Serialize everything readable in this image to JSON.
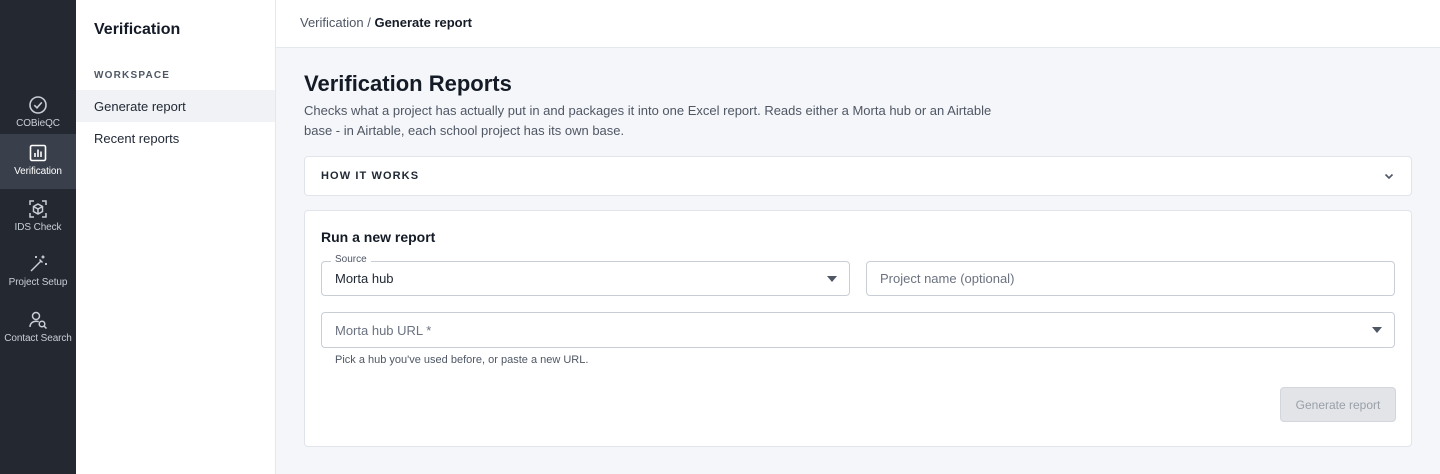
{
  "rail": {
    "items": [
      {
        "label": "COBieQC",
        "icon": "check-circle-icon"
      },
      {
        "label": "Verification",
        "icon": "bar-chart-icon"
      },
      {
        "label": "IDS Check",
        "icon": "cube-scan-icon"
      },
      {
        "label": "Project Setup",
        "icon": "magic-wand-icon"
      },
      {
        "label": "Contact Search",
        "icon": "user-search-icon"
      }
    ]
  },
  "nav": {
    "title": "Verification",
    "section": "WORKSPACE",
    "items": [
      {
        "label": "Generate report"
      },
      {
        "label": "Recent reports"
      }
    ]
  },
  "breadcrumb": {
    "parent": "Verification",
    "separator": "/",
    "current": "Generate report"
  },
  "page": {
    "title": "Verification Reports",
    "description": "Checks what a project has actually put in and packages it into one Excel report. Reads either a Morta hub or an Airtable base - in Airtable, each school project has its own base."
  },
  "accordion": {
    "title": "HOW IT WORKS"
  },
  "form": {
    "title": "Run a new report",
    "source_label": "Source",
    "source_value": "Morta hub",
    "project_placeholder": "Project name (optional)",
    "hub_url_placeholder": "Morta hub URL *",
    "hub_helper": "Pick a hub you've used before, or paste a new URL.",
    "submit_label": "Generate report"
  },
  "colors": {
    "rail_bg": "#232831",
    "rail_active": "#3a404b",
    "page_bg": "#f5f6f9",
    "disabled_button": "#e2e4e8"
  }
}
